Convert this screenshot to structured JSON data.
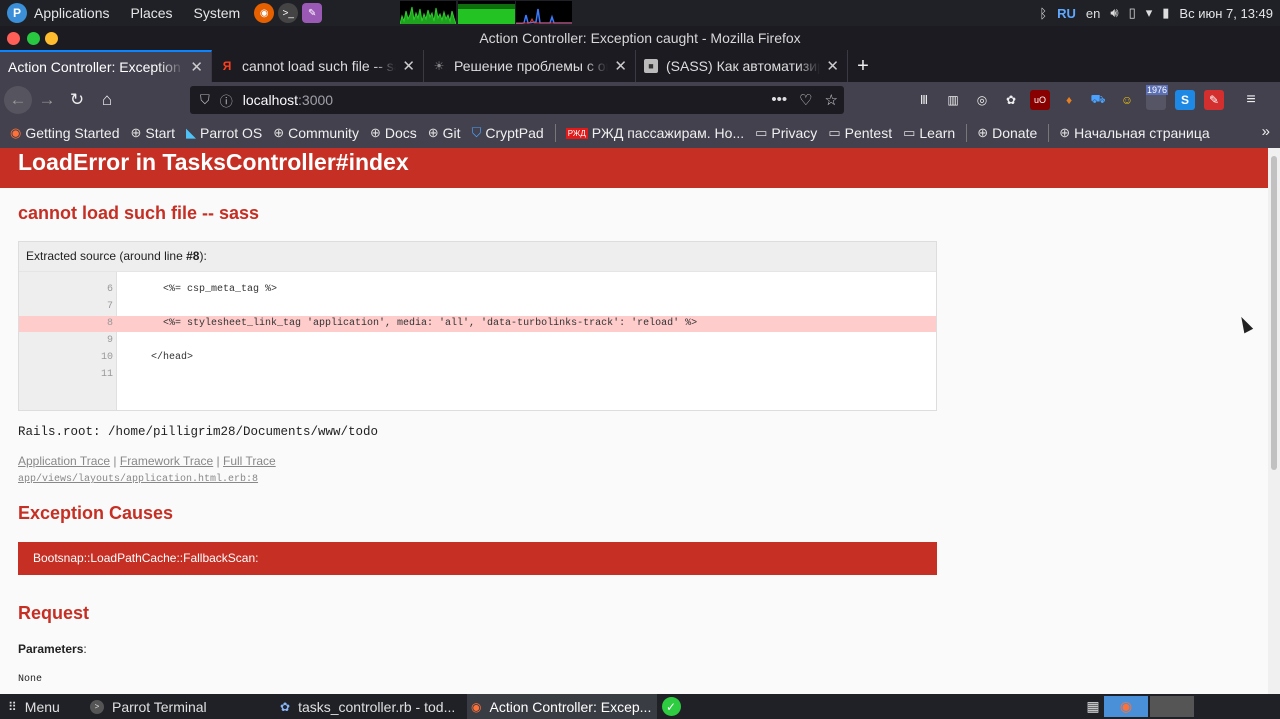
{
  "system_panel": {
    "menus": [
      "Applications",
      "Places",
      "System"
    ],
    "kbd_layout": "RU",
    "lang": "en",
    "clock": "Вс июн 7, 13:49"
  },
  "window": {
    "title": "Action Controller: Exception caught - Mozilla Firefox"
  },
  "tabs": [
    {
      "title": "Action Controller: Exception",
      "active": true
    },
    {
      "title": "cannot load such file -- sass",
      "active": false
    },
    {
      "title": "Решение проблемы с ошибкой",
      "active": false
    },
    {
      "title": "(SASS) Как автоматизировать",
      "active": false
    }
  ],
  "navbar": {
    "url_host": "localhost",
    "url_port": ":3000",
    "badge": "1976"
  },
  "bookmarks": [
    "Getting Started",
    "Start",
    "Parrot OS",
    "Community",
    "Docs",
    "Git",
    "CryptPad",
    "РЖД пассажирам. Но...",
    "Privacy",
    "Pentest",
    "Learn",
    "Donate",
    "Начальная страница"
  ],
  "page": {
    "header": "LoadError in TasksController#index",
    "message": "cannot load such file -- sass",
    "source": {
      "head_prefix": "Extracted source (around line ",
      "head_line": "#8",
      "head_suffix": "):",
      "lines": [
        {
          "n": "6",
          "code": "    <%= csp_meta_tag %>",
          "highlight": false
        },
        {
          "n": "7",
          "code": "",
          "highlight": false
        },
        {
          "n": "8",
          "code": "    <%= stylesheet_link_tag 'application', media: 'all', 'data-turbolinks-track': 'reload' %>",
          "highlight": true
        },
        {
          "n": "9",
          "code": "",
          "highlight": false
        },
        {
          "n": "10",
          "code": "  </head>",
          "highlight": false
        },
        {
          "n": "11",
          "code": "",
          "highlight": false
        }
      ]
    },
    "rails_root": "Rails.root: /home/pilligrim28/Documents/www/todo",
    "trace_links": [
      "Application Trace",
      "Framework Trace",
      "Full Trace"
    ],
    "trace_path": "app/views/layouts/application.html.erb:8",
    "causes_heading": "Exception Causes",
    "cause": "Bootsnap::LoadPathCache::FallbackScan:",
    "request_heading": "Request",
    "params_label": "Parameters",
    "params_value": "None"
  },
  "taskbar": {
    "menu": "Menu",
    "items": [
      "Parrot Terminal",
      "tasks_controller.rb - tod...",
      "Action Controller: Excep..."
    ]
  },
  "colors": {
    "rails_red": "#c52f24",
    "highlight_line": "#ffcccc",
    "firefox_accent": "#0a84ff"
  }
}
